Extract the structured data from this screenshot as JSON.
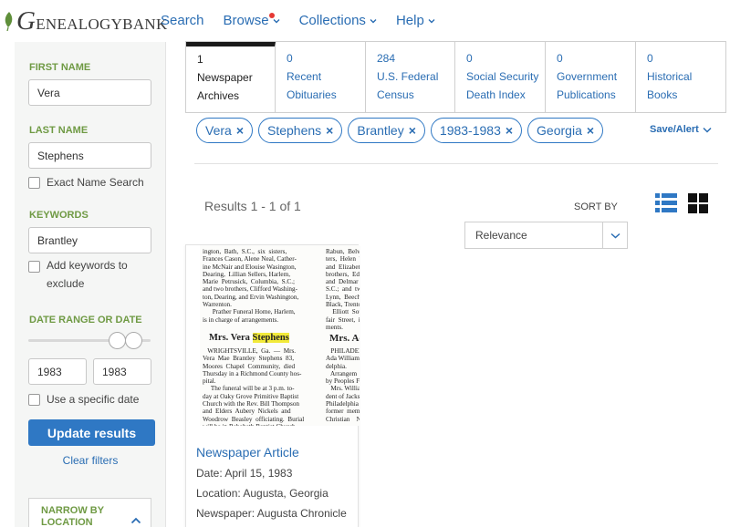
{
  "logo": {
    "first_letter": "G",
    "rest": "ENEALOGYBANK"
  },
  "nav": [
    {
      "label": "Search",
      "has_chevron": false
    },
    {
      "label": "Browse",
      "has_chevron": true,
      "badge_color": "#e53935"
    },
    {
      "label": "Collections",
      "has_chevron": true
    },
    {
      "label": "Help",
      "has_chevron": true
    }
  ],
  "sidebar": {
    "first_name_label": "FIRST NAME",
    "first_name_value": "Vera",
    "last_name_label": "LAST NAME",
    "last_name_value": "Stephens",
    "exact_name_label": "Exact Name Search",
    "keywords_label": "KEYWORDS",
    "keywords_value": "Brantley",
    "exclude_label_1": "Add keywords to",
    "exclude_label_2": "exclude",
    "date_range_label": "DATE RANGE OR DATE",
    "date_from": "1983",
    "date_to": "1983",
    "specific_date_label": "Use a specific date",
    "update_button": "Update results",
    "clear_filters": "Clear filters",
    "narrow_line_1": "NARROW BY",
    "narrow_line_2": "LOCATION"
  },
  "tabs": [
    {
      "count": "1",
      "line1": "Newspaper",
      "line2": "Archives",
      "active": true
    },
    {
      "count": "0",
      "line1": "Recent",
      "line2": "Obituaries",
      "active": false
    },
    {
      "count": "284",
      "line1": "U.S. Federal",
      "line2": "Census",
      "active": false
    },
    {
      "count": "0",
      "line1": "Social Security",
      "line2": "Death Index",
      "active": false
    },
    {
      "count": "0",
      "line1": "Government",
      "line2": "Publications",
      "active": false
    },
    {
      "count": "0",
      "line1": "Historical",
      "line2": "Books",
      "active": false
    }
  ],
  "chips": [
    "Vera",
    "Stephens",
    "Brantley",
    "1983-1983",
    "Georgia"
  ],
  "chip_remove_glyph": "×",
  "save_alert": "Save/Alert",
  "results": {
    "count_text": "Results 1 - 1 of 1",
    "sort_label": "SORT BY",
    "sort_value": "Relevance"
  },
  "result_card": {
    "title": "Newspaper Article",
    "date": "Date: April 15, 1983",
    "location": "Location: Augusta, Georgia",
    "newspaper": "Newspaper: Augusta Chronicle",
    "thumb": {
      "col1_top": "ington,  Bath,  S.C.,  six  sisters,\nFrances Cason, Alene Neal, Cather-\nine McNair and Elouise Wasington,\nDearing,  Lillian Sellers, Harlem,\nMarie  Petrusick,  Columbia,  S.C.;\nand two brothers, Clifford Washing-\nton, Dearing, and Ervin Washington,\nWarrenton.\n      Prather Funeral Home, Harlem,\nis in charge of arrangements.",
      "col1_head": "Mrs. Vera Stephens",
      "col1_head_plain": "Mrs. Vera ",
      "col1_head_hl": "Stephens",
      "col1_bottom": "   WRIGHTSVILLE,  Ga.  —  Mrs.\nVera  Mae  Brantley  Stephens  83,\nMoores  Chapel  Community,  died\nThursday in a Richmond County hos-\npital.\n     The funeral will be at 3 p.m. to-\nday at Oaky Grove Primitive Baptist\nChurch with the Rev. Bill Thompson\nand  Elders  Aubery  Nickels  and\nWoodrow  Beasley  officiating.  Burial\nwill be in Rehobeth Baptist Church",
      "col2_top": "Rabun,  Belvec\nters,  Helen  '\nand  Elizabeth\nbrothers,  Edw\nand  Delmar  l\nS.C.;  and  two\nLynn,  Beech\nBlack, Trentor\n    Elliott  Sou\nfair  Street,  is\nments.",
      "col2_head": "Mrs. Ac",
      "col2_bottom": "   PHILADEI\nAda Williams\ndelphia.\n   Arrangem\nby Peoples Fu\n   Mrs. Willia\ndent of Jacks\nPhiladelphia t\nformer  mem\nChristian    N"
    }
  },
  "colors": {
    "link": "#2a6db3",
    "accent_green": "#6f9a44",
    "button": "#2f78c4",
    "highlight": "#f2ea3a",
    "sidebar_bg": "#f5f6f5"
  },
  "icons": {
    "logo": "leaf-icon",
    "chevron": "chevron-down-icon",
    "list_view": "list-view-icon",
    "grid_view": "grid-view-icon",
    "collapse": "chevron-up-icon"
  }
}
